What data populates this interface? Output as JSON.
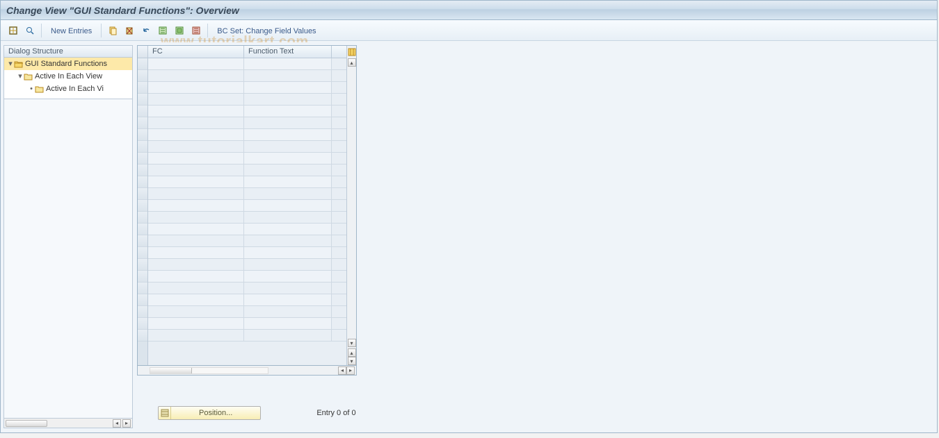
{
  "title": "Change View \"GUI Standard Functions\": Overview",
  "toolbar": {
    "new_entries": "New Entries",
    "bc_set": "BC Set: Change Field Values"
  },
  "left_panel": {
    "header": "Dialog Structure",
    "node1": "GUI Standard Functions",
    "node2": "Active In Each View",
    "node3": "Active In Each Vi"
  },
  "grid": {
    "col_fc": "FC",
    "col_ft": "Function Text"
  },
  "footer": {
    "position": "Position...",
    "entry": "Entry 0 of 0"
  },
  "watermark": "www.tutorialkart.com"
}
